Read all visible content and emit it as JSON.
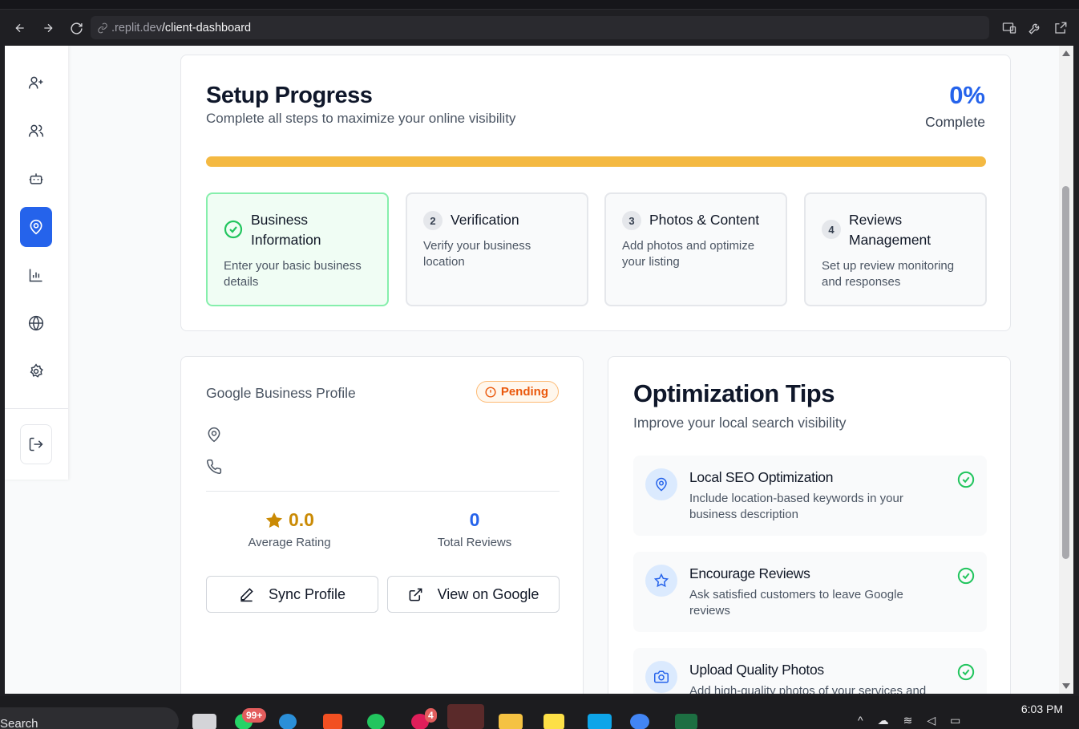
{
  "browser": {
    "url_host": ".replit.dev",
    "url_path": "/client-dashboard"
  },
  "sidebar": {
    "items": [
      {
        "icon": "user-plus-icon"
      },
      {
        "icon": "users-icon"
      },
      {
        "icon": "bot-icon"
      },
      {
        "icon": "map-pin-icon",
        "active": true
      },
      {
        "icon": "bar-chart-icon"
      },
      {
        "icon": "globe-icon"
      },
      {
        "icon": "settings-icon"
      }
    ],
    "logout_icon": "logout-icon"
  },
  "setup": {
    "title": "Setup Progress",
    "subtitle": "Complete all steps to maximize your online visibility",
    "percent": "0%",
    "percent_label": "Complete",
    "progress_value": 0,
    "progress_color": "#f4b942",
    "steps": [
      {
        "number": "",
        "title": "Business Information",
        "description": "Enter your basic business details",
        "status": "completed"
      },
      {
        "number": "2",
        "title": "Verification",
        "description": "Verify your business location",
        "status": "pending"
      },
      {
        "number": "3",
        "title": "Photos & Content",
        "description": "Add photos and optimize your listing",
        "status": "pending"
      },
      {
        "number": "4",
        "title": "Reviews Management",
        "description": "Set up review monitoring and responses",
        "status": "pending"
      }
    ]
  },
  "gbp": {
    "title": "Google Business Profile",
    "status": "Pending",
    "rating_value": "0.0",
    "rating_label": "Average Rating",
    "reviews_value": "0",
    "reviews_label": "Total Reviews",
    "sync_label": "Sync Profile",
    "view_label": "View on Google"
  },
  "tips": {
    "title": "Optimization Tips",
    "subtitle": "Improve your local search visibility",
    "items": [
      {
        "icon": "map-pin-icon",
        "title": "Local SEO Optimization",
        "description": "Include location-based keywords in your business description"
      },
      {
        "icon": "star-icon",
        "title": "Encourage Reviews",
        "description": "Ask satisfied customers to leave Google reviews"
      },
      {
        "icon": "camera-icon",
        "title": "Upload Quality Photos",
        "description": "Add high-quality photos of your services and"
      }
    ]
  },
  "taskbar": {
    "search_label": "Search",
    "whatsapp_badge": "99+",
    "slack_badge": "4",
    "time": "6:03 PM"
  },
  "colors": {
    "accent": "#2563eb",
    "success": "#22c55e",
    "warning": "#ea580c",
    "star": "#ca8a04"
  }
}
